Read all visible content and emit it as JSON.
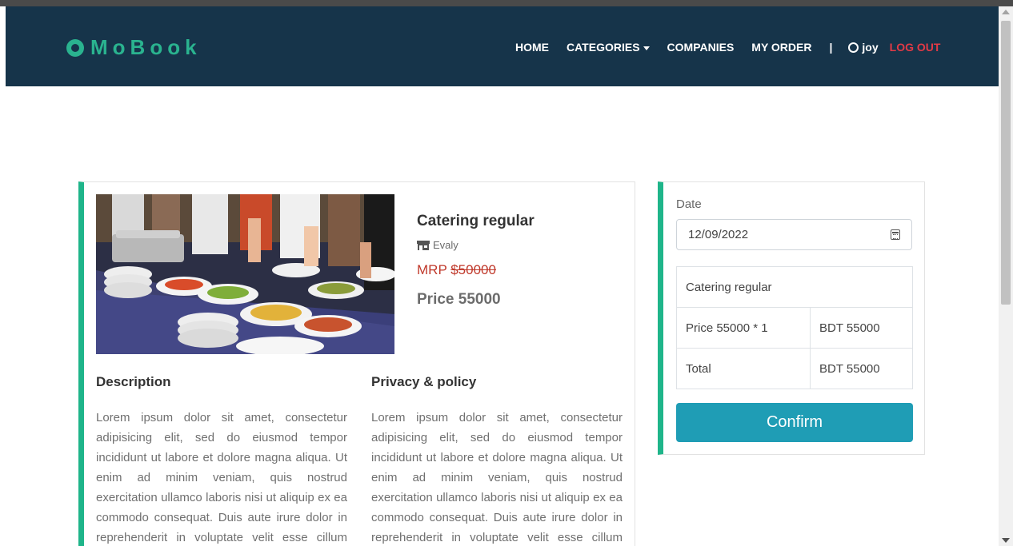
{
  "brand": {
    "name": "MoBook"
  },
  "nav": {
    "home": "HOME",
    "categories": "CATEGORIES",
    "companies": "COMPANIES",
    "my_order": "MY ORDER",
    "separator": "|",
    "user": "joy",
    "logout": "LOG OUT"
  },
  "product": {
    "title": "Catering regular",
    "company": "Evaly",
    "mrp_label": "MRP ",
    "mrp_value": "$50000",
    "price": "Price 55000",
    "image_icon": "catering-food-photo"
  },
  "description": {
    "title": "Description",
    "text": "Lorem ipsum dolor sit amet, consectetur adipisicing elit, sed do eiusmod tempor incididunt ut labore et dolore magna aliqua. Ut enim ad minim veniam, quis nostrud exercitation ullamco laboris nisi ut aliquip ex ea commodo consequat. Duis aute irure dolor in reprehenderit in voluptate velit esse cillum dolore eu fugiat nulla pariatur."
  },
  "privacy": {
    "title": "Privacy & policy",
    "text": "Lorem ipsum dolor sit amet, consectetur adipisicing elit, sed do eiusmod tempor incididunt ut labore et dolore magna aliqua. Ut enim ad minim veniam, quis nostrud exercitation ullamco laboris nisi ut aliquip ex ea commodo consequat. Duis aute irure dolor in reprehenderit in voluptate velit esse cillum dolore eu fugiat nulla pariatur."
  },
  "order": {
    "date_label": "Date",
    "date_value": "12/09/2022",
    "item_name": "Catering regular",
    "line_label": "Price 55000 * 1",
    "line_amount": "BDT 55000",
    "total_label": "Total",
    "total_amount": "BDT 55000",
    "confirm_label": "Confirm"
  },
  "colors": {
    "navbar": "#16344a",
    "brand": "#2ab38f",
    "accent_border": "#1fb58a",
    "logout": "#e23a46",
    "mrp": "#c0392b",
    "confirm": "#1f9db5"
  }
}
